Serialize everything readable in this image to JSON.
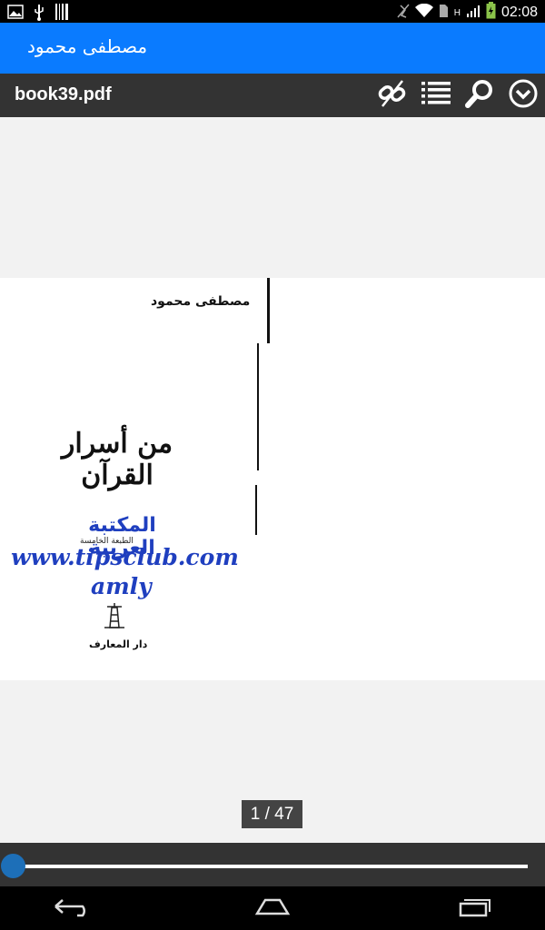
{
  "status_bar": {
    "time": "02:08",
    "network_label": "H",
    "icons": [
      "image-icon",
      "usb-icon",
      "barcode-icon",
      "mute-icon",
      "wifi-icon",
      "sim-icon",
      "signal-icon",
      "battery-icon"
    ]
  },
  "app": {
    "title": "مصطفى محمود"
  },
  "toolbar": {
    "file_name": "book39.pdf",
    "buttons": [
      "link-icon",
      "list-icon",
      "search-icon",
      "chevron-down-circle-icon"
    ]
  },
  "page": {
    "author": "مصطفى محمود",
    "book_title": "من أسرار القرآن",
    "watermark_arabic": "المكتبة العربية",
    "edition": "الطبعة الخامسة",
    "watermark_url": "www.tipsclub.com",
    "watermark_name": "amly",
    "publisher": "دار المعارف"
  },
  "page_indicator": {
    "current": 1,
    "total": 47,
    "label": "1 / 47"
  },
  "slider": {
    "progress": 0.0
  },
  "colors": {
    "title_bar": "#0a7bff",
    "toolbar": "#333333",
    "watermark": "#1f3fbf",
    "slider_thumb": "#1d6fb8"
  }
}
